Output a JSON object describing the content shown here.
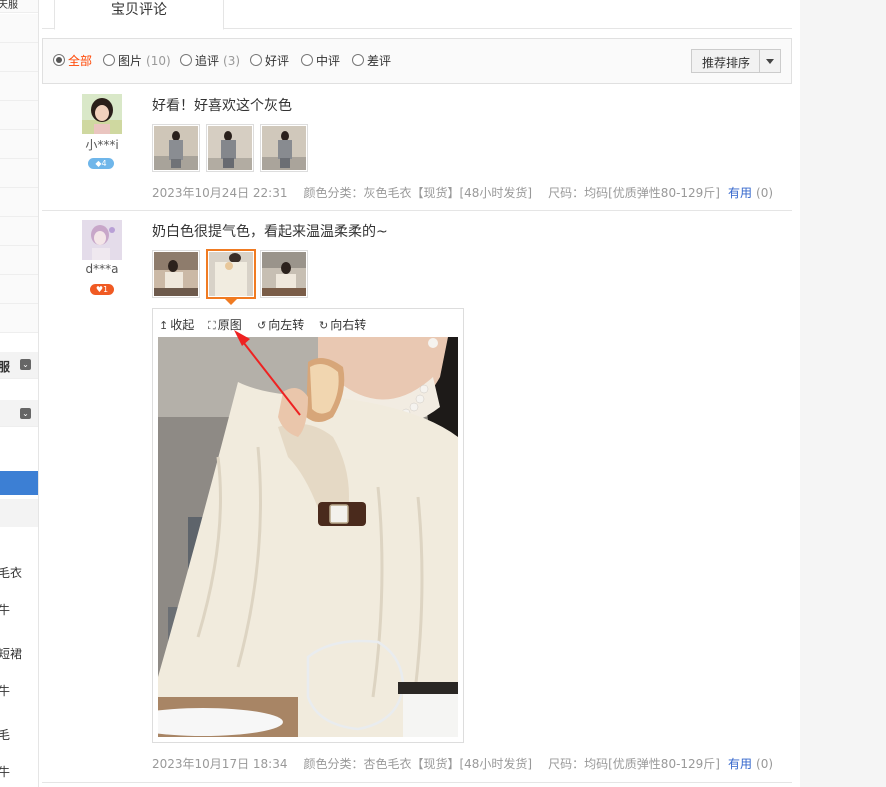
{
  "left_rail": {
    "items": [
      "天服",
      "服",
      "毛衣",
      "牛",
      "短裙",
      "牛",
      "毛",
      "牛"
    ]
  },
  "tab": {
    "label": "宝贝评论"
  },
  "filters": [
    {
      "label": "全部",
      "count": "",
      "selected": true
    },
    {
      "label": "图片",
      "count": "(10)",
      "selected": false
    },
    {
      "label": "追评",
      "count": "(3)",
      "selected": false
    },
    {
      "label": "好评",
      "count": "",
      "selected": false
    },
    {
      "label": "中评",
      "count": "",
      "selected": false
    },
    {
      "label": "差评",
      "count": "",
      "selected": false
    }
  ],
  "sort": {
    "label": "推荐排序"
  },
  "reviews": [
    {
      "user": "小***i",
      "badge": "4",
      "text": "好看！好喜欢这个灰色",
      "date": "2023年10月24日 22:31",
      "color_spec": "颜色分类：灰色毛衣【现货】[48小时发货]",
      "size_spec": "尺码：均码[优质弹性80-129斤]",
      "useful_label": "有用",
      "useful_count": "(0)"
    },
    {
      "user": "d***a",
      "badge": "1",
      "text": "奶白色很提气色，看起来温温柔柔的~",
      "date": "2023年10月17日 18:34",
      "color_spec": "颜色分类：杏色毛衣【现货】[48小时发货]",
      "size_spec": "尺码：均码[优质弹性80-129斤]",
      "useful_label": "有用",
      "useful_count": "(0)"
    }
  ],
  "viewer": {
    "collapse": "收起",
    "original": "原图",
    "rotate_left": "向左转",
    "rotate_right": "向右转"
  },
  "colors": {
    "accent": "#f40",
    "link": "#3366cc",
    "thumb_selected": "#f07b22",
    "annotation": "#ee2222"
  }
}
